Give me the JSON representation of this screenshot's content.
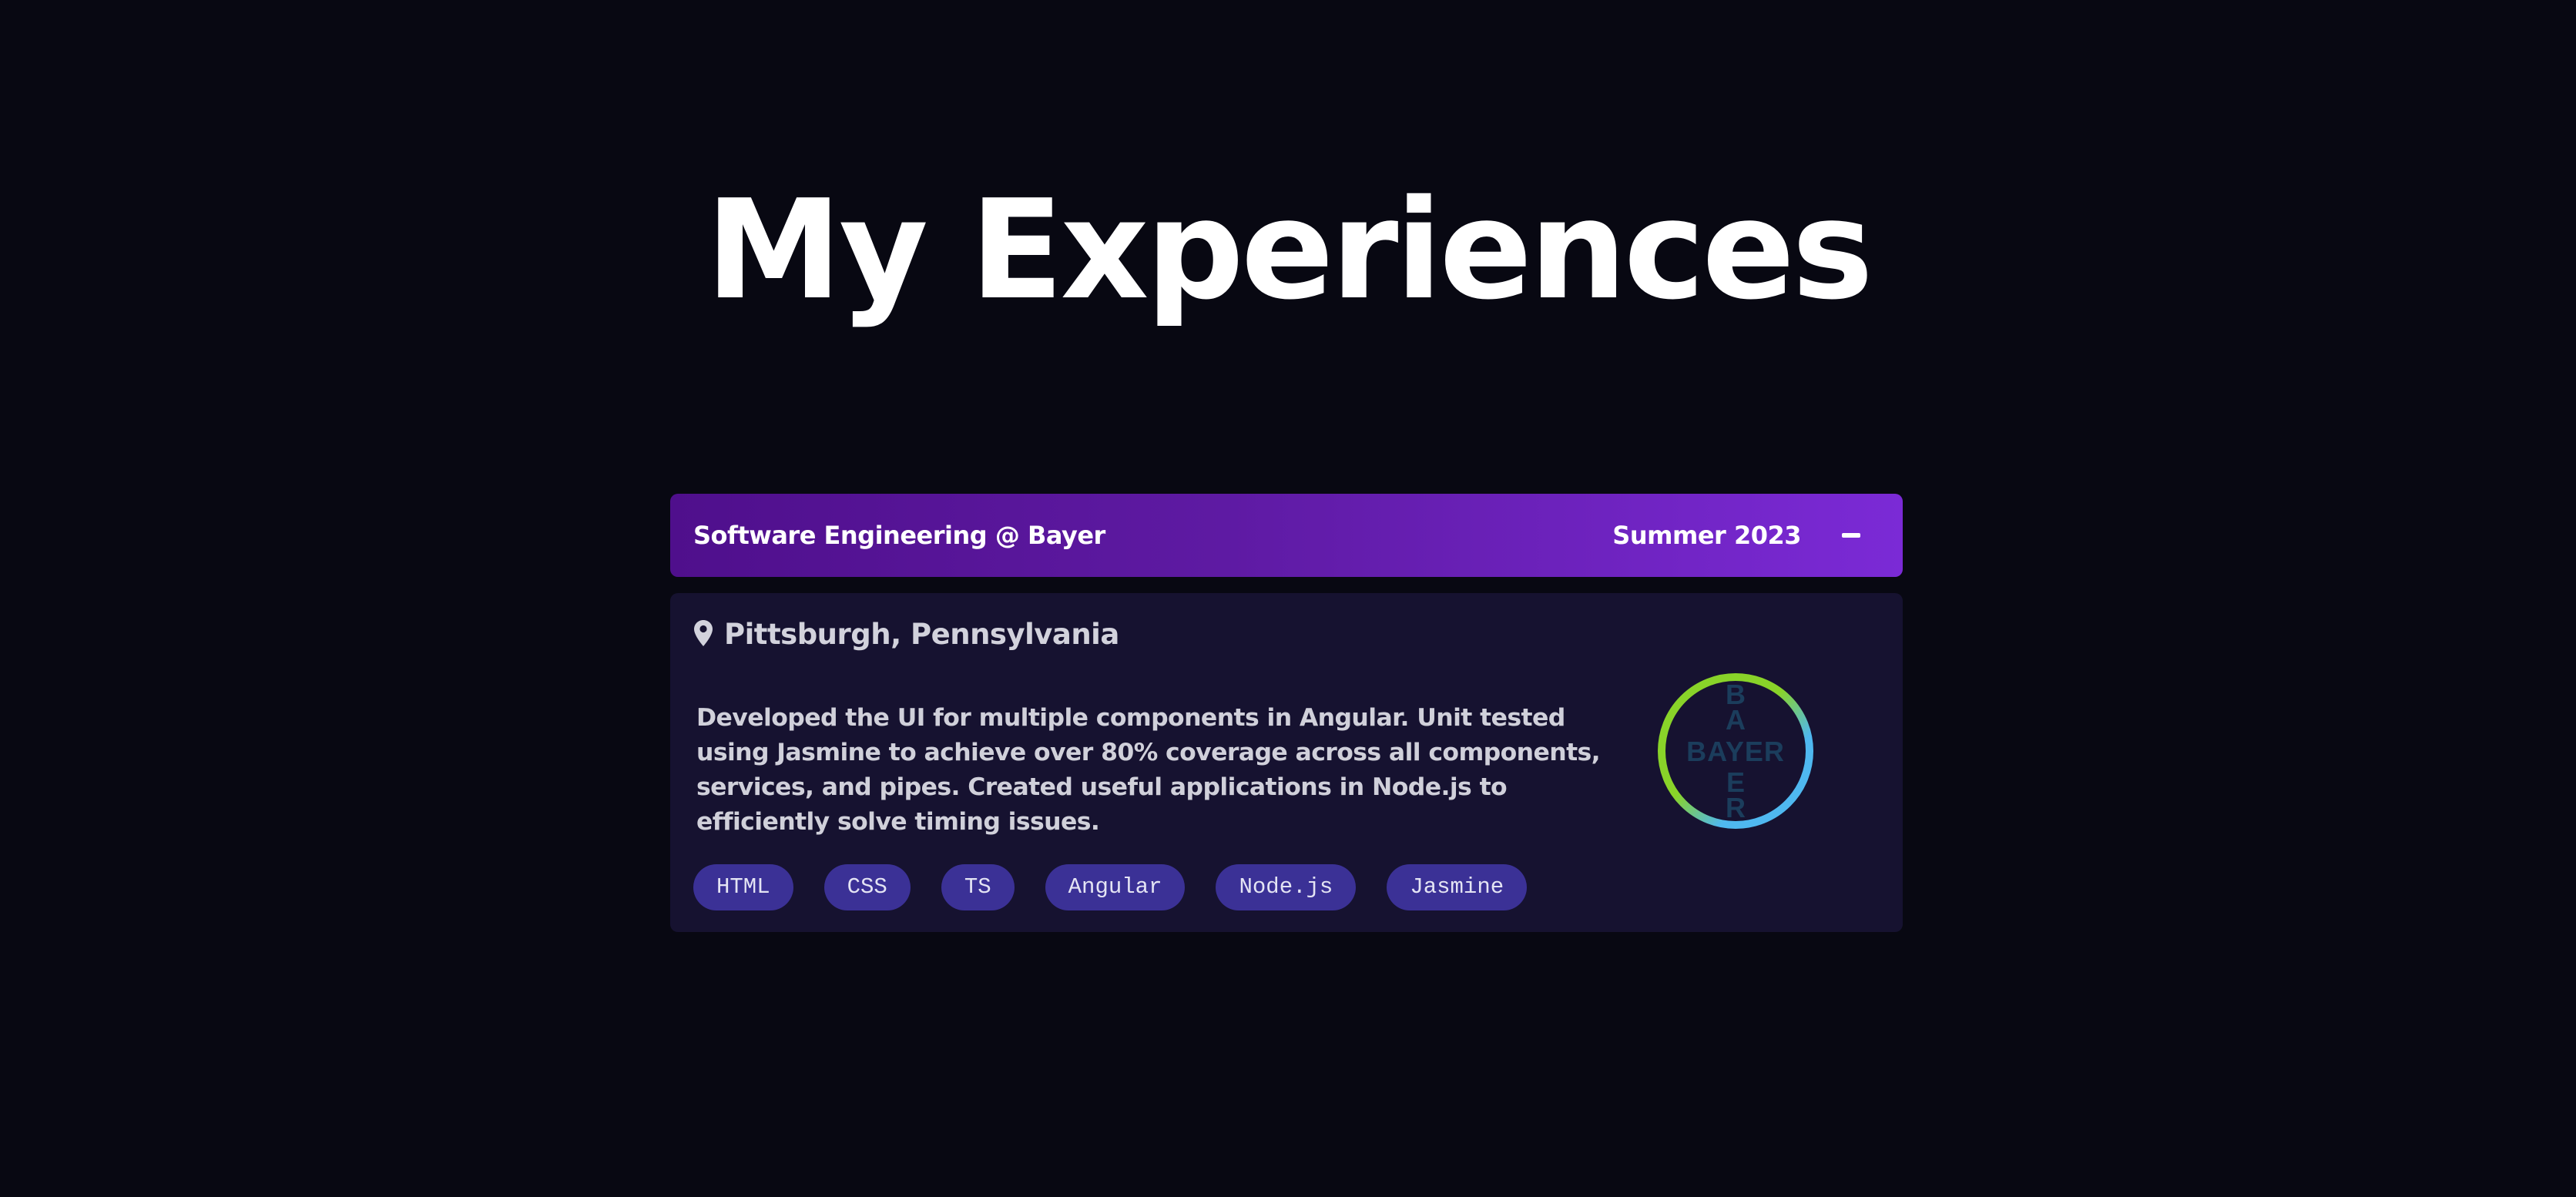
{
  "page": {
    "title": "My Experiences"
  },
  "experience": {
    "role": "Software Engineering @ Bayer",
    "date": "Summer 2023",
    "collapse_icon": "minus-icon",
    "location_icon": "map-pin-icon",
    "location": "Pittsburgh, Pennsylvania",
    "description": "Developed the UI for multiple components in Angular. Unit tested using Jasmine to achieve over 80% coverage across all components, services, and pipes. Created useful applications in Node.js to efficiently solve timing issues.",
    "skills": [
      "HTML",
      "CSS",
      "TS",
      "Angular",
      "Node.js",
      "Jasmine"
    ],
    "logo": {
      "vertical": [
        "B",
        "A",
        "Y",
        "E",
        "R"
      ],
      "horizontal": "BAYER"
    }
  },
  "colors": {
    "background": "#080812",
    "header_gradient_start": "#4f0f8c",
    "header_gradient_end": "#7b2ad6",
    "card_background": "#161230",
    "tag_background": "#3b3196",
    "logo_green": "#89d329",
    "logo_blue": "#4fb8f0",
    "logo_text": "#1b3d5c"
  }
}
